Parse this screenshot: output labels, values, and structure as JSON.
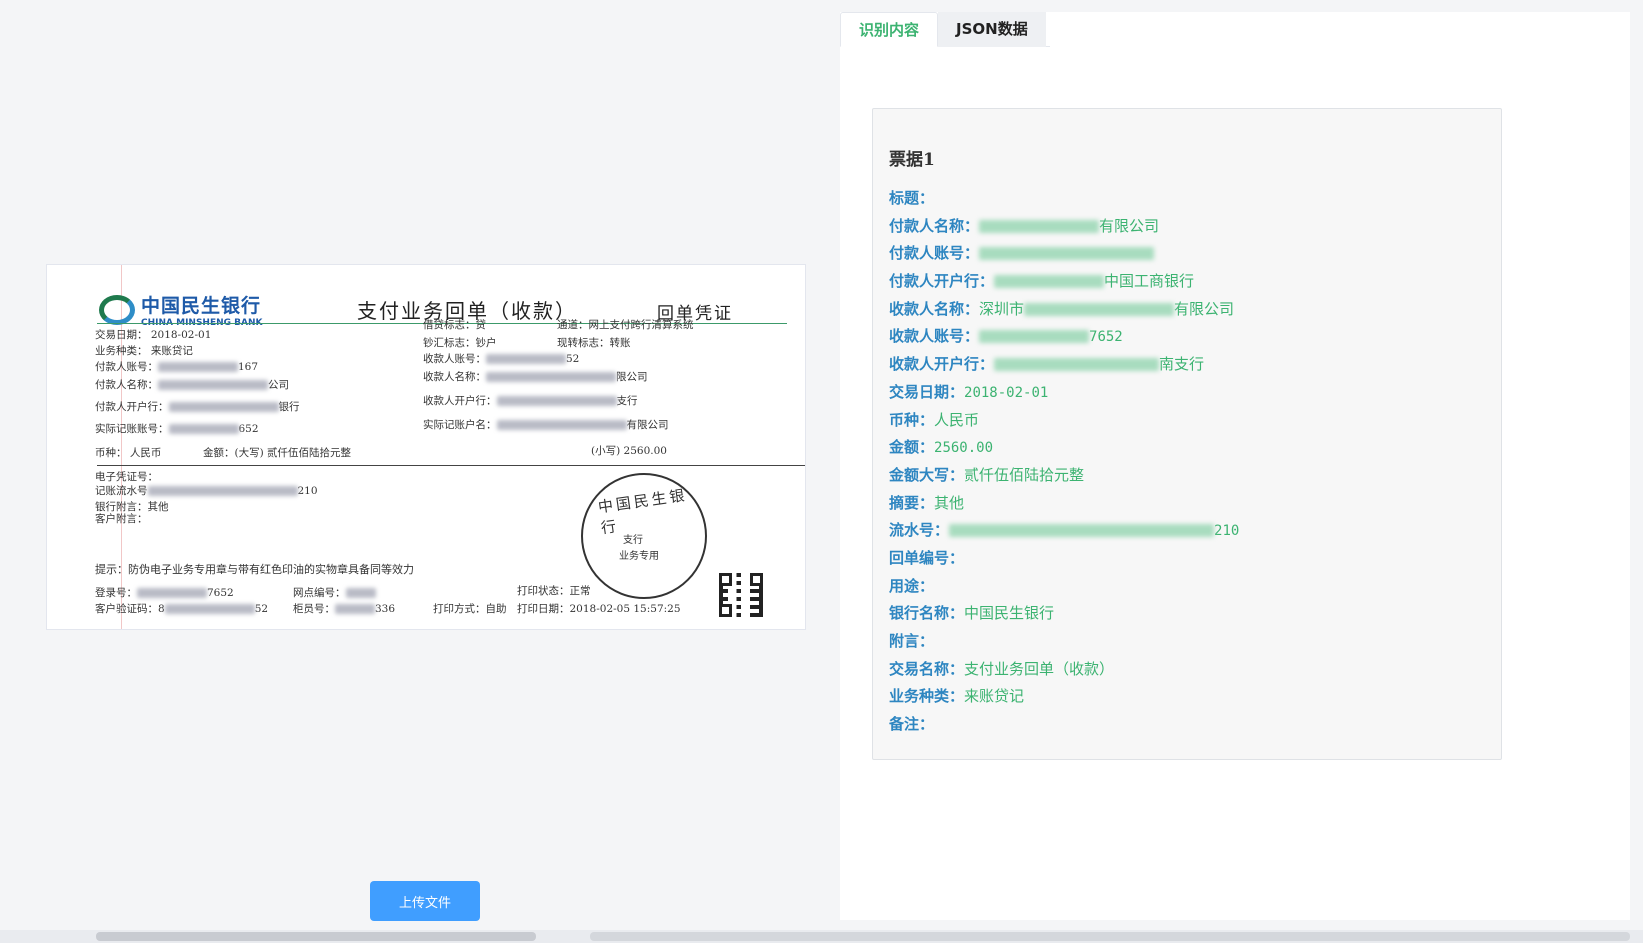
{
  "tabs": {
    "recognized": "识别内容",
    "json": "JSON数据"
  },
  "upload_button": "上传文件",
  "receipt": {
    "bank_zh": "中国民生银行",
    "bank_en": "CHINA MINSHENG BANK",
    "title": "支付业务回单（收款）",
    "tag": "回单凭证",
    "lines": {
      "date": "交易日期：    2018-02-01",
      "biz": "业务种类：    来账贷记",
      "payer_acct": "付款人账号：",
      "payer_acct_tail": "167",
      "payer_name": "付款人名称：",
      "payer_name_tail": "公司",
      "payer_bank": "付款人开户行：",
      "payer_bank_tail": "银行",
      "real_acct": "实际记账账号：",
      "real_acct_tail": "652",
      "debit_flag": "借贷标志：贷",
      "channel": "通道：网上支付跨行清算系统",
      "cash_flag": "钞汇标志：钞户",
      "transfer_flag": "现转标志：转账",
      "payee_acct": "收款人账号：",
      "payee_acct_tail": "52",
      "payee_name": "收款人名称：",
      "payee_name_tail": "限公司",
      "payee_bank": "收款人开户行：",
      "payee_bank_tail": "支行",
      "real_name": "实际记账户名：",
      "real_name_tail": "有限公司",
      "currency": "币种：  人民币",
      "amount_big": "金额：(大写)    贰仟伍佰陆拾元整",
      "amount_small": "(小写)  2560.00",
      "voucher": "电子凭证号：",
      "serial": "记账流水号",
      "serial_tail": "210",
      "bank_note": "银行附言：其他",
      "cust_note": "客户附言：",
      "tip": "提示：防伪电子业务专用章与带有红色印油的实物章具备同等效力",
      "login": "登录号：",
      "login_tail": "7652",
      "branch_no": "网点编号：",
      "print_status": "打印状态：正常",
      "verify": "客户验证码：8",
      "verify_tail": "52",
      "teller": "柜员号：",
      "teller_tail": "336",
      "print_mode": "打印方式：自助",
      "print_date": "打印日期：2018-02-05  15:57:25",
      "stamp_top": "中国民生银行",
      "stamp_mid": "支行",
      "stamp_bot": "业务专用"
    }
  },
  "card": {
    "title": "票据1",
    "fields": [
      {
        "key": "标题：",
        "value": ""
      },
      {
        "key": "付款人名称：",
        "value": "有限公司",
        "blur": 120
      },
      {
        "key": "付款人账号：",
        "value": "",
        "blur": 175
      },
      {
        "key": "付款人开户行：",
        "value": "中国工商银行",
        "blur": 110
      },
      {
        "key": "收款人名称：",
        "value": "深圳市",
        "value_tail": "有限公司",
        "blur": 150
      },
      {
        "key": "收款人账号：",
        "value": "7652",
        "blur": 110,
        "mono": true
      },
      {
        "key": "收款人开户行：",
        "value": "南支行",
        "blur": 165
      },
      {
        "key": "交易日期：",
        "value": "2018-02-01",
        "mono": true
      },
      {
        "key": "币种：",
        "value": "人民币"
      },
      {
        "key": "金额：",
        "value": "2560.00",
        "mono": true
      },
      {
        "key": "金额大写：",
        "value": "贰仟伍佰陆拾元整"
      },
      {
        "key": "摘要：",
        "value": "其他"
      },
      {
        "key": "流水号：",
        "value": "210",
        "blur": 265,
        "mono": true
      },
      {
        "key": "回单编号：",
        "value": ""
      },
      {
        "key": "用途：",
        "value": ""
      },
      {
        "key": "银行名称：",
        "value": "中国民生银行"
      },
      {
        "key": "附言：",
        "value": ""
      },
      {
        "key": "交易名称：",
        "value": "支付业务回单（收款）"
      },
      {
        "key": "业务种类：",
        "value": "来账贷记"
      },
      {
        "key": "备注：",
        "value": ""
      }
    ]
  },
  "colors": {
    "accent_green": "#3cb371",
    "key_blue": "#2e86c1",
    "button_blue": "#409eff"
  }
}
